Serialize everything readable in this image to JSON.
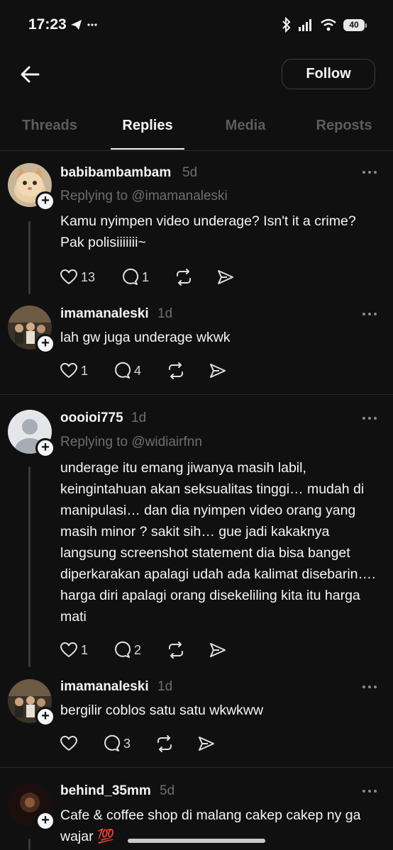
{
  "status": {
    "time": "17:23",
    "battery": "40"
  },
  "header": {
    "follow_label": "Follow"
  },
  "tabs": [
    {
      "label": "Threads"
    },
    {
      "label": "Replies"
    },
    {
      "label": "Media"
    },
    {
      "label": "Reposts"
    }
  ],
  "posts": [
    {
      "username": "babibambambam",
      "time": "5d",
      "replying_to": "Replying to @imamanaleski",
      "text": "Kamu nyimpen video underage? Isn't it a crime? Pak polisiiiiiii~",
      "likes": "13",
      "replies": "1"
    },
    {
      "username": "imamanaleski",
      "time": "1d",
      "text": "lah gw juga underage wkwk",
      "likes": "1",
      "replies": "4"
    },
    {
      "username": "oooioi775",
      "time": "1d",
      "replying_to": "Replying to @widiairfnn",
      "text": "underage itu emang jiwanya masih labil, keingintahuan akan seksualitas tinggi… mudah di manipulasi… dan dia nyimpen video orang yang masih minor ? sakit sih… gue jadi kakaknya langsung screenshot statement dia bisa banget diperkarakan apalagi udah ada kalimat disebarin…. harga diri apalagi orang disekeliling kita itu harga mati",
      "likes": "1",
      "replies": "2"
    },
    {
      "username": "imamanaleski",
      "time": "1d",
      "text": "bergilir coblos satu satu wkwkww",
      "likes": "",
      "replies": "3"
    },
    {
      "username": "behind_35mm",
      "time": "5d",
      "text": "Cafe & coffee shop di malang cakep cakep ny ga wajar 💯"
    }
  ],
  "icons": {
    "like": "heart-icon",
    "reply": "comment-icon",
    "repost": "repost-icon",
    "share": "send-icon",
    "more": "more-dots-icon"
  }
}
